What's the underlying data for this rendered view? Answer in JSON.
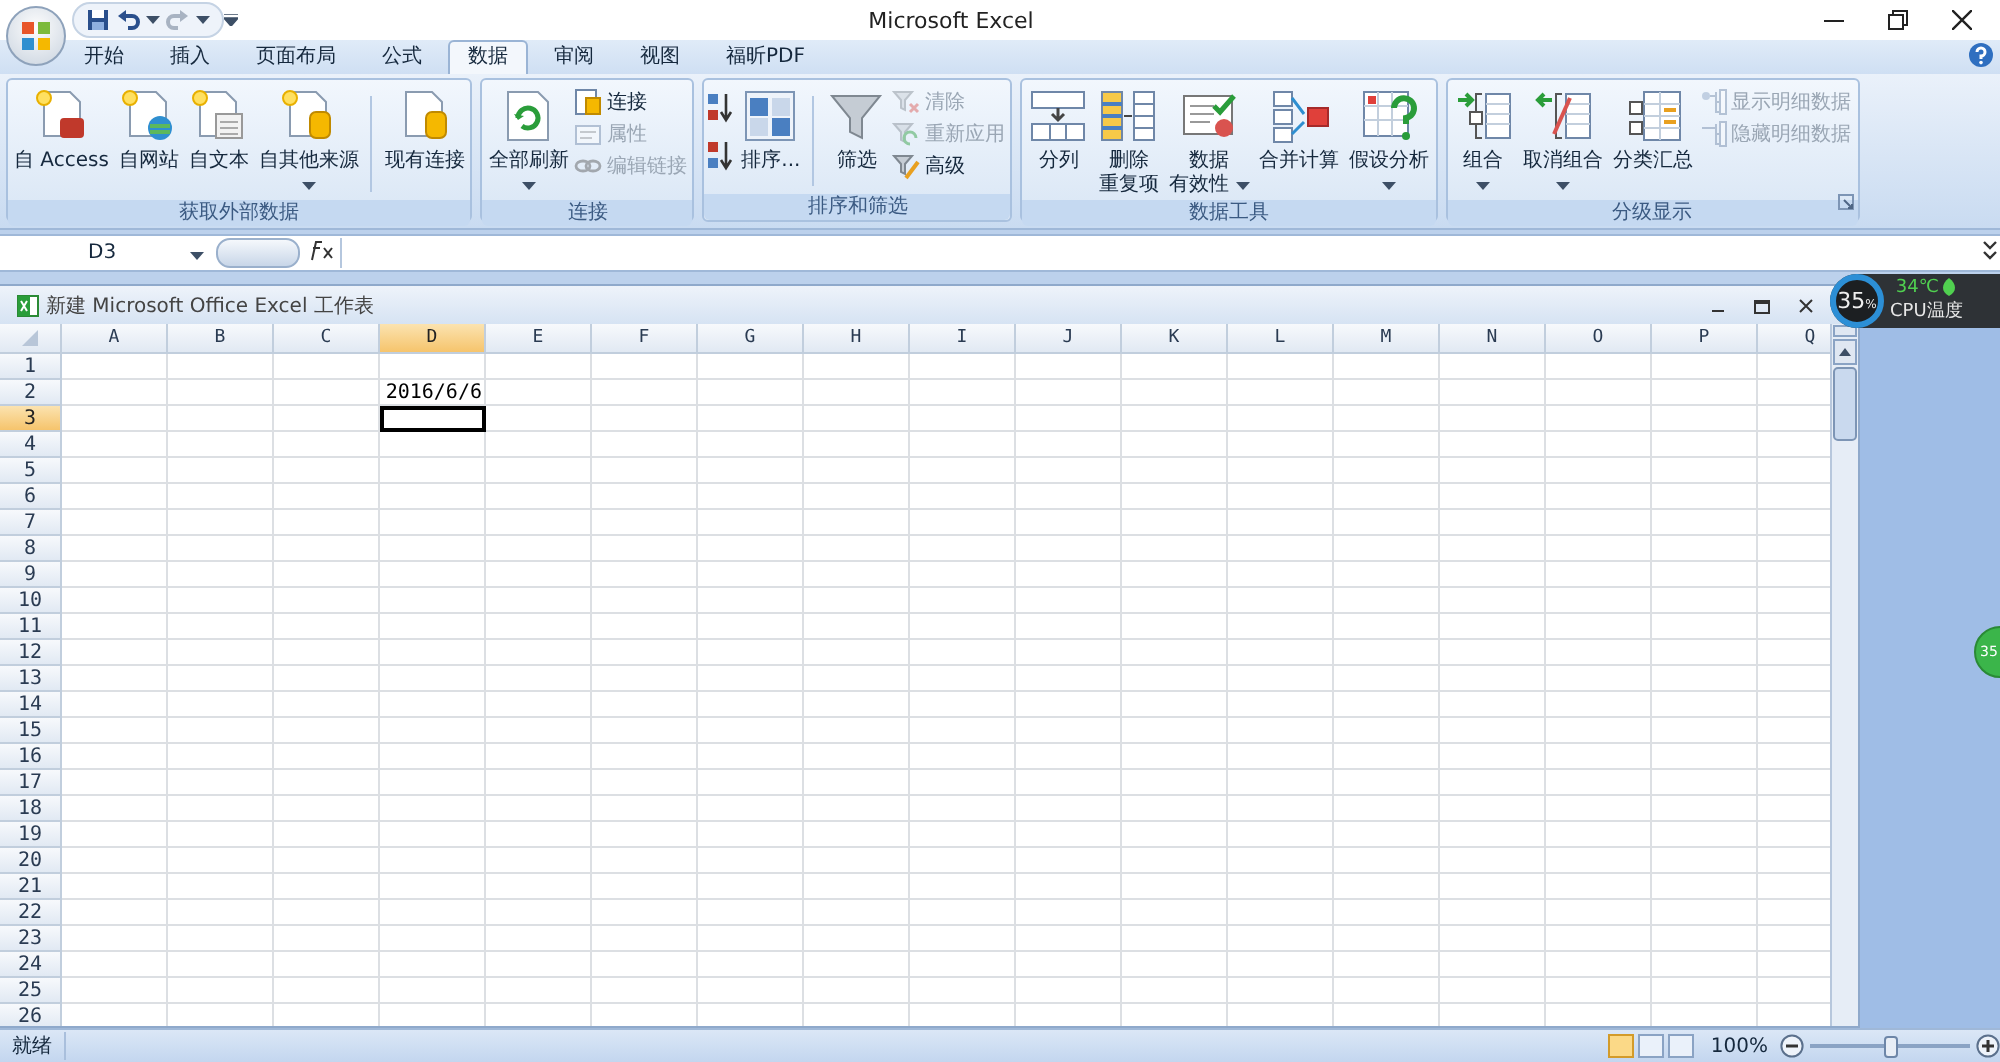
{
  "title_bar": {
    "title": "Microsoft Excel"
  },
  "tabs": [
    {
      "label": "开始",
      "selected": false
    },
    {
      "label": "插入",
      "selected": false
    },
    {
      "label": "页面布局",
      "selected": false
    },
    {
      "label": "公式",
      "selected": false
    },
    {
      "label": "数据",
      "selected": true
    },
    {
      "label": "审阅",
      "selected": false
    },
    {
      "label": "视图",
      "selected": false
    },
    {
      "label": "福昕PDF",
      "selected": false
    }
  ],
  "ribbon_groups": [
    {
      "label": "获取外部数据",
      "launcher": false,
      "items": [
        {
          "kind": "large",
          "lines": [
            "自 Access"
          ],
          "dropdown": false
        },
        {
          "kind": "large",
          "lines": [
            "自网站"
          ],
          "dropdown": false
        },
        {
          "kind": "large",
          "lines": [
            "自文本"
          ],
          "dropdown": false
        },
        {
          "kind": "large",
          "lines": [
            "自其他来源"
          ],
          "dropdown": true
        },
        {
          "kind": "separator"
        },
        {
          "kind": "large",
          "lines": [
            "现有连接"
          ],
          "dropdown": false
        }
      ]
    },
    {
      "label": "连接",
      "launcher": false,
      "items": [
        {
          "kind": "large",
          "lines": [
            "全部刷新"
          ],
          "dropdown": true
        },
        {
          "kind": "stack",
          "buttons": [
            {
              "label": "连接",
              "disabled": false
            },
            {
              "label": "属性",
              "disabled": true
            },
            {
              "label": "编辑链接",
              "disabled": true
            }
          ]
        }
      ]
    },
    {
      "label": "排序和筛选",
      "launcher": false,
      "items": [
        {
          "kind": "sort-pair"
        },
        {
          "kind": "large",
          "lines": [
            "排序..."
          ],
          "dropdown": false
        },
        {
          "kind": "separator"
        },
        {
          "kind": "large",
          "lines": [
            "筛选"
          ],
          "dropdown": false
        },
        {
          "kind": "stack",
          "buttons": [
            {
              "label": "清除",
              "disabled": true
            },
            {
              "label": "重新应用",
              "disabled": true
            },
            {
              "label": "高级",
              "disabled": false
            }
          ]
        }
      ]
    },
    {
      "label": "数据工具",
      "launcher": false,
      "items": [
        {
          "kind": "large",
          "lines": [
            "分列"
          ],
          "dropdown": false
        },
        {
          "kind": "large",
          "lines": [
            "删除",
            "重复项"
          ],
          "dropdown": false
        },
        {
          "kind": "large",
          "lines": [
            "数据",
            "有效性"
          ],
          "dropdown": true
        },
        {
          "kind": "large",
          "lines": [
            "合并计算"
          ],
          "dropdown": false
        },
        {
          "kind": "large",
          "lines": [
            "假设分析"
          ],
          "dropdown": true
        }
      ]
    },
    {
      "label": "分级显示",
      "launcher": true,
      "items": [
        {
          "kind": "large",
          "lines": [
            "组合"
          ],
          "dropdown": true
        },
        {
          "kind": "large",
          "lines": [
            "取消组合"
          ],
          "dropdown": true
        },
        {
          "kind": "large",
          "lines": [
            "分类汇总"
          ],
          "dropdown": false
        },
        {
          "kind": "stack",
          "buttons": [
            {
              "label": "显示明细数据",
              "disabled": true
            },
            {
              "label": "隐藏明细数据",
              "disabled": true
            }
          ]
        }
      ]
    }
  ],
  "formula_bar": {
    "name_box": "D3"
  },
  "workbook": {
    "title": "新建 Microsoft Office Excel 工作表",
    "columns": [
      {
        "label": "A",
        "selected": false
      },
      {
        "label": "B",
        "selected": false
      },
      {
        "label": "C",
        "selected": false
      },
      {
        "label": "D",
        "selected": true
      },
      {
        "label": "E",
        "selected": false
      },
      {
        "label": "F",
        "selected": false
      },
      {
        "label": "G",
        "selected": false
      },
      {
        "label": "H",
        "selected": false
      },
      {
        "label": "I",
        "selected": false
      },
      {
        "label": "J",
        "selected": false
      },
      {
        "label": "K",
        "selected": false
      },
      {
        "label": "L",
        "selected": false
      },
      {
        "label": "M",
        "selected": false
      },
      {
        "label": "N",
        "selected": false
      },
      {
        "label": "O",
        "selected": false
      },
      {
        "label": "P",
        "selected": false
      },
      {
        "label": "Q",
        "selected": false
      }
    ],
    "rows": [
      {
        "label": "1",
        "selected": false
      },
      {
        "label": "2",
        "selected": false,
        "cells": [
          null,
          null,
          null,
          "2016/6/6"
        ]
      },
      {
        "label": "3",
        "selected": true
      },
      {
        "label": "4",
        "selected": false
      },
      {
        "label": "5",
        "selected": false
      },
      {
        "label": "6",
        "selected": false
      },
      {
        "label": "7",
        "selected": false
      },
      {
        "label": "8",
        "selected": false
      },
      {
        "label": "9",
        "selected": false
      },
      {
        "label": "10",
        "selected": false
      },
      {
        "label": "11",
        "selected": false
      },
      {
        "label": "12",
        "selected": false
      },
      {
        "label": "13",
        "selected": false
      },
      {
        "label": "14",
        "selected": false
      },
      {
        "label": "15",
        "selected": false
      },
      {
        "label": "16",
        "selected": false
      },
      {
        "label": "17",
        "selected": false
      },
      {
        "label": "18",
        "selected": false
      },
      {
        "label": "19",
        "selected": false
      },
      {
        "label": "20",
        "selected": false
      },
      {
        "label": "21",
        "selected": false
      },
      {
        "label": "22",
        "selected": false
      },
      {
        "label": "23",
        "selected": false
      },
      {
        "label": "24",
        "selected": false
      },
      {
        "label": "25",
        "selected": false
      },
      {
        "label": "26",
        "selected": false
      }
    ]
  },
  "status_bar": {
    "text": "就绪",
    "views": [
      {
        "selected": true
      },
      {
        "selected": false
      },
      {
        "selected": false
      }
    ],
    "zoom": "100%",
    "zoom_slider": {
      "level": 0.5
    }
  },
  "cpu_widget": {
    "usage": "35",
    "unit": "%",
    "temperature": "34℃",
    "label": "CPU温度"
  },
  "side_badge": {
    "text": "35"
  }
}
